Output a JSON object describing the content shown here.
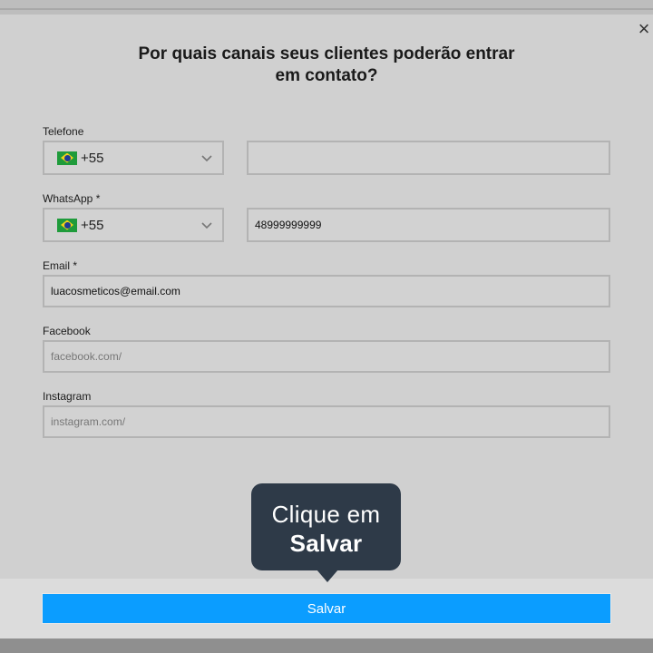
{
  "modal": {
    "title_line1": "Por quais canais seus clientes poderão entrar",
    "title_line2": "em contato?",
    "close_glyph": "×"
  },
  "fields": {
    "telefone": {
      "label": "Telefone",
      "country_code": "+55",
      "value": "",
      "flag_icon": "brazil-flag-icon"
    },
    "whatsapp": {
      "label": "WhatsApp *",
      "country_code": "+55",
      "value": "48999999999",
      "flag_icon": "brazil-flag-icon"
    },
    "email": {
      "label": "Email *",
      "value": "luacosmeticos@email.com"
    },
    "facebook": {
      "label": "Facebook",
      "placeholder": "facebook.com/"
    },
    "instagram": {
      "label": "Instagram",
      "placeholder": "instagram.com/"
    }
  },
  "tooltip": {
    "line1": "Clique em",
    "line2": "Salvar"
  },
  "footer": {
    "save_label": "Salvar"
  },
  "colors": {
    "accent": "#0b9dff",
    "tooltip_bg": "#2e3a48",
    "modal_bg": "#d0d0d0"
  }
}
